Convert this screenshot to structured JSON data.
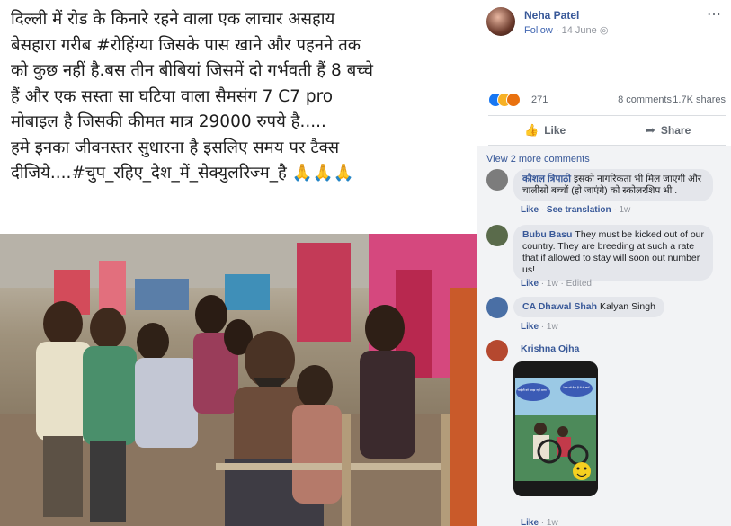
{
  "post": {
    "caption_lines": [
      "दिल्ली में रोड के किनारे रहने वाला एक लाचार असहाय",
      "बेसहारा गरीब #रोहिंग्या जिसके पास खाने और पहनने तक",
      "को कुछ नहीं है.बस तीन बीबियां जिसमें दो गर्भवती हैं 8 बच्चे",
      "हैं और एक सस्ता सा घटिया वाला सैमसंग 7 C7 pro",
      "मोबाइल है जिसकी कीमत मात्र 29000 रुपये है.....",
      "हमे इनका जीवनस्तर सुधारना है इसलिए समय पर टैक्स",
      "दीजिये....#चुप_रहिए_देश_में_सेक्युलरिज्म_है 🙏🙏🙏"
    ]
  },
  "header": {
    "author": "Neha Patel",
    "follow": "Follow",
    "date": "14 June",
    "more_icon": "⋯"
  },
  "reactions": {
    "count": "271",
    "comments": "8 comments",
    "shares": "1.7K shares"
  },
  "actions": {
    "like": "Like",
    "share": "Share"
  },
  "comments": {
    "view_more": "View 2 more comments",
    "items": [
      {
        "author": "कौशल त्रिपाठी",
        "text": "इसको नागरिकता भी मिल जाएगी और चालीसों बच्चों (हो जाएंगे) को स्कोलरशिप भी .",
        "like": "Like",
        "translate": "See translation",
        "time": "1w"
      },
      {
        "author": "Bubu Basu",
        "text": "They must be kicked out of our country. They are breeding at such a rate that if allowed to stay will soon out number us!",
        "like": "Like",
        "time": "1w",
        "edited": "Edited"
      },
      {
        "author": "CA Dhawal Shah",
        "text": "Kalyan Singh",
        "like": "Like",
        "time": "1w"
      },
      {
        "author": "Krishna Ojha",
        "like": "Like",
        "time": "1w",
        "sticker_text_left": "\"भाईजी को समझ नहीं आया ?\"",
        "sticker_text_right": "\"रात जो देता है ये ले कर\""
      }
    ]
  }
}
